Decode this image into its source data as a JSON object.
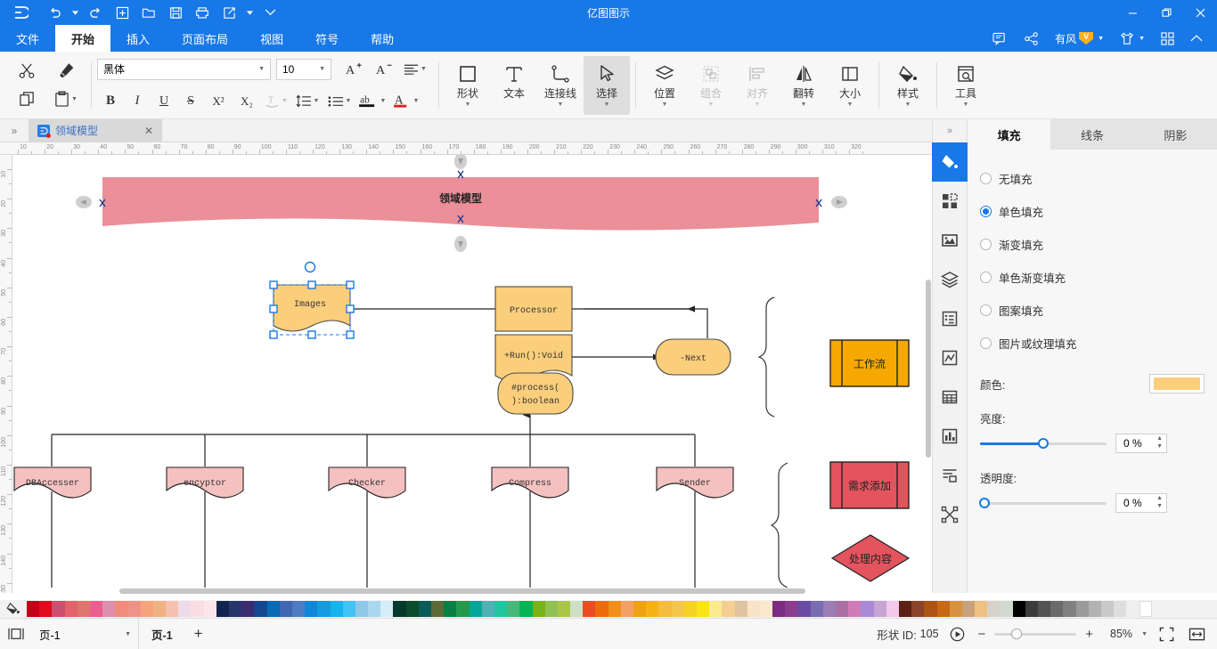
{
  "window": {
    "title": "亿图图示",
    "logo": "edraw-logo-icon",
    "minimize": "—",
    "maximize": "❐",
    "close": "✕"
  },
  "quick_access": [
    {
      "name": "undo-button",
      "glyph": "↺",
      "caret": true
    },
    {
      "name": "redo-button",
      "glyph": "↻",
      "caret": false
    },
    {
      "name": "new-button",
      "glyph": "⊞",
      "caret": false
    },
    {
      "name": "open-button",
      "glyph": "🗀",
      "caret": false
    },
    {
      "name": "save-button",
      "glyph": "🖫",
      "caret": false
    },
    {
      "name": "print-button",
      "glyph": "🖶",
      "caret": false
    },
    {
      "name": "export-share-button",
      "glyph": "⇱",
      "caret": true
    },
    {
      "name": "customize-quick-access-button",
      "glyph": "⌄",
      "caret": false
    }
  ],
  "menu": {
    "items": [
      {
        "label": "文件",
        "active": false
      },
      {
        "label": "开始",
        "active": true
      },
      {
        "label": "插入",
        "active": false
      },
      {
        "label": "页面布局",
        "active": false
      },
      {
        "label": "视图",
        "active": false
      },
      {
        "label": "符号",
        "active": false
      },
      {
        "label": "帮助",
        "active": false
      }
    ],
    "right": {
      "feedback_icon": "comment-icon",
      "share_icon": "share-icon",
      "account_name": "有风",
      "vip_badge": "V",
      "theme_icon": "shirt-icon",
      "apps_icon": "grid-apps-icon",
      "collapse_icon": "chevron-up-icon"
    }
  },
  "ribbon": {
    "clipboard": [
      {
        "name": "cut-button",
        "glyph": "✂"
      },
      {
        "name": "format-painter-button",
        "glyph": "🖌"
      },
      {
        "name": "copy-button",
        "glyph": "⧉"
      },
      {
        "name": "paste-button",
        "glyph": "📋",
        "caret": true
      }
    ],
    "font": {
      "family": "黑体",
      "size": "10",
      "grow_font": "A⁺",
      "shrink_font": "A⁻",
      "align_icon": "align-icon",
      "bold": "B",
      "italic": "I",
      "underline": "U",
      "strikethrough": "S",
      "superscript": "X²",
      "subscript": "X₂",
      "text_curve_icon": "text-curve-icon",
      "line_spacing_icon": "line-spacing-icon",
      "bullets_icon": "bullets-icon",
      "text_highlight_icon": "ab-highlight-icon",
      "font_color_icon": "font-color-icon"
    },
    "tools": [
      {
        "name": "shape-tool",
        "label": "形状",
        "icon": "square-icon",
        "caret": true,
        "active": false,
        "disabled": false
      },
      {
        "name": "text-tool",
        "label": "文本",
        "icon": "text-T-icon",
        "caret": false,
        "active": false,
        "disabled": false
      },
      {
        "name": "connector-tool",
        "label": "连接线",
        "icon": "connector-icon",
        "caret": true,
        "active": false,
        "disabled": false
      },
      {
        "name": "select-tool",
        "label": "选择",
        "icon": "cursor-arrow-icon",
        "caret": true,
        "active": true,
        "disabled": false
      }
    ],
    "arrange": [
      {
        "name": "position-tool",
        "label": "位置",
        "icon": "layers-stack-icon",
        "caret": true,
        "disabled": false
      },
      {
        "name": "group-tool",
        "label": "组合",
        "icon": "group-icon",
        "caret": true,
        "disabled": true
      },
      {
        "name": "align-tool",
        "label": "对齐",
        "icon": "align-left-icon",
        "caret": true,
        "disabled": true
      },
      {
        "name": "flip-tool",
        "label": "翻转",
        "icon": "flip-icon",
        "caret": true,
        "disabled": false
      },
      {
        "name": "size-tool",
        "label": "大小",
        "icon": "size-icon",
        "caret": true,
        "disabled": false
      }
    ],
    "extras": [
      {
        "name": "style-tool",
        "label": "样式",
        "icon": "paint-bucket-icon",
        "caret": true,
        "disabled": false
      },
      {
        "name": "tools-tool",
        "label": "工具",
        "icon": "tools-search-icon",
        "caret": true,
        "disabled": false
      }
    ]
  },
  "tabstrip": {
    "expand_icon": "chevron-double-right-icon",
    "document_tab": {
      "label": "领域模型",
      "close": "✕",
      "modified": true
    }
  },
  "rulers": {
    "horizontal": [
      "10",
      "20",
      "30",
      "40",
      "50",
      "60",
      "70",
      "80",
      "90",
      "100",
      "110",
      "120",
      "130",
      "140",
      "150",
      "160",
      "170",
      "180",
      "190",
      "200",
      "210",
      "220",
      "230",
      "240",
      "250",
      "260",
      "270",
      "280",
      "290",
      "300",
      "310",
      "320"
    ],
    "vertical": [
      "10",
      "20",
      "30",
      "40",
      "50",
      "60",
      "70",
      "80",
      "90",
      "100",
      "110",
      "120",
      "130",
      "140",
      "150"
    ]
  },
  "right_rail": {
    "expand_icon": "chevron-double-right-icon",
    "items": [
      {
        "name": "fill-panel-icon",
        "icon": "paint-bucket-icon",
        "active": true
      },
      {
        "name": "quick-shapes-icon",
        "icon": "four-squares-icon",
        "active": false
      },
      {
        "name": "image-icon",
        "icon": "picture-icon",
        "active": false
      },
      {
        "name": "layers-icon",
        "icon": "layers-icon",
        "active": false
      },
      {
        "name": "properties-icon",
        "icon": "document-list-icon",
        "active": false
      },
      {
        "name": "chart-icon",
        "icon": "chart-line-icon",
        "active": false
      },
      {
        "name": "table-icon",
        "icon": "table-grid-icon",
        "active": false
      },
      {
        "name": "infographic-icon",
        "icon": "infographic-icon",
        "active": false
      },
      {
        "name": "notes-icon",
        "icon": "notes-icon",
        "active": false
      },
      {
        "name": "distribute-icon",
        "icon": "distribute-nodes-icon",
        "active": false
      }
    ]
  },
  "panel": {
    "tabs": [
      {
        "label": "填充",
        "active": true
      },
      {
        "label": "线条",
        "active": false
      },
      {
        "label": "阴影",
        "active": false
      }
    ],
    "fill_options": [
      {
        "label": "无填充",
        "selected": false
      },
      {
        "label": "单色填充",
        "selected": true
      },
      {
        "label": "渐变填充",
        "selected": false
      },
      {
        "label": "单色渐变填充",
        "selected": false
      },
      {
        "label": "图案填充",
        "selected": false
      },
      {
        "label": "图片或纹理填充",
        "selected": false
      }
    ],
    "color_label": "颜色:",
    "color_value": "#FBCE7C",
    "brightness_label": "亮度:",
    "brightness_value": "0 %",
    "brightness_pct": 50,
    "opacity_label": "透明度:",
    "opacity_value": "0 %",
    "opacity_pct": 0
  },
  "palette": {
    "icon": "paint-bucket-icon",
    "colors": [
      "#c10019",
      "#e00c1c",
      "#cb4f6e",
      "#e4626a",
      "#e0756f",
      "#ea5f8e",
      "#dd8fae",
      "#ef8c7b",
      "#ee9388",
      "#f5a579",
      "#f2b183",
      "#f5c0ae",
      "#eddbe9",
      "#fbdde6",
      "#fbe7ea",
      "#12244e",
      "#26366b",
      "#3d2b72",
      "#13488e",
      "#0a6ab4",
      "#3f68b0",
      "#4c7cc1",
      "#0f87d8",
      "#139ce0",
      "#18b2ec",
      "#3fc4f4",
      "#8fc7ea",
      "#a9d7ef",
      "#d6edf8",
      "#05392c",
      "#0a4c2c",
      "#0a5a57",
      "#5b6b38",
      "#068046",
      "#24994a",
      "#06a79b",
      "#4fb0b6",
      "#1fc79e",
      "#46b97a",
      "#07b352",
      "#79b318",
      "#90c154",
      "#a9c64b",
      "#cde0c1",
      "#ea4c23",
      "#ee6b0b",
      "#f09018",
      "#f1a066",
      "#eda213",
      "#f5b217",
      "#f7bc3c",
      "#f4c74a",
      "#f6d229",
      "#fae317",
      "#fbeb8e",
      "#f4cf90",
      "#e2c39f",
      "#f8e3c6",
      "#fbe8cd",
      "#7b2b82",
      "#8b3c8e",
      "#6a4ba3",
      "#7a6cb0",
      "#9a7eb5",
      "#ab6fa4",
      "#d17ab5",
      "#a98ad8",
      "#c6a5d5",
      "#f5c7e8",
      "#5c2116",
      "#8a4229",
      "#ab5418",
      "#c76a14",
      "#d89240",
      "#c8a07c",
      "#eec180",
      "#d6d2ca",
      "#d2dacf",
      "#000000",
      "#3b3b3b",
      "#535353",
      "#6a6a6a",
      "#808080",
      "#9a9a9a",
      "#b2b2b2",
      "#c9c9c9",
      "#dedede",
      "#efefef",
      "#ffffff"
    ]
  },
  "status_bar": {
    "view_icon": "page-view-icon",
    "page_select": "页-1",
    "page_chip": "页-1",
    "add_page": "+",
    "shape_id_label": "形状 ID:",
    "shape_id_value": "105",
    "play_icon": "play-circle-icon",
    "zoom_out": "−",
    "zoom_in": "+",
    "zoom_value": "85%",
    "zoom_pct": 20,
    "fit_page_icon": "fit-page-icon",
    "fit_width_icon": "fit-width-icon"
  },
  "diagram": {
    "banner": {
      "text": "领域模型",
      "fill": "#eb8f98",
      "text_color": "#ffffff"
    },
    "selected_shape": {
      "label": "Images",
      "fill": "#FBCE7C"
    },
    "shapes": [
      {
        "name": "processor-node",
        "label": "Processor",
        "fill": "#FBCE7C",
        "type": "rect"
      },
      {
        "name": "run-method-node",
        "label": "+Run():Void",
        "fill": "#FBCE7C",
        "type": "document"
      },
      {
        "name": "process-method-node",
        "label": "#process(\n):boolean",
        "fill": "#FBCE7C",
        "type": "rounded"
      },
      {
        "name": "next-node",
        "label": "-Next",
        "fill": "#FBCE7C",
        "type": "rounded"
      },
      {
        "name": "dbaccesser-node",
        "label": "DBAccesser",
        "fill": "#F5C1C0",
        "type": "document"
      },
      {
        "name": "encyptor-node",
        "label": "encyptor",
        "fill": "#F5C1C0",
        "type": "document"
      },
      {
        "name": "checker-node",
        "label": "Checker",
        "fill": "#F5C1C0",
        "type": "document"
      },
      {
        "name": "compress-node",
        "label": "Compress",
        "fill": "#F5C1C0",
        "type": "document"
      },
      {
        "name": "sender-node",
        "label": "Sender",
        "fill": "#F5C1C0",
        "type": "document"
      },
      {
        "name": "workflow-node",
        "label": "工作流",
        "fill": "#F5A800",
        "type": "process-bars"
      },
      {
        "name": "requirement-add-node",
        "label": "需求添加",
        "fill": "#E3545E",
        "type": "process-bars"
      },
      {
        "name": "process-content-node",
        "label": "处理内容",
        "fill": "#E3545E",
        "type": "diamond"
      }
    ]
  }
}
